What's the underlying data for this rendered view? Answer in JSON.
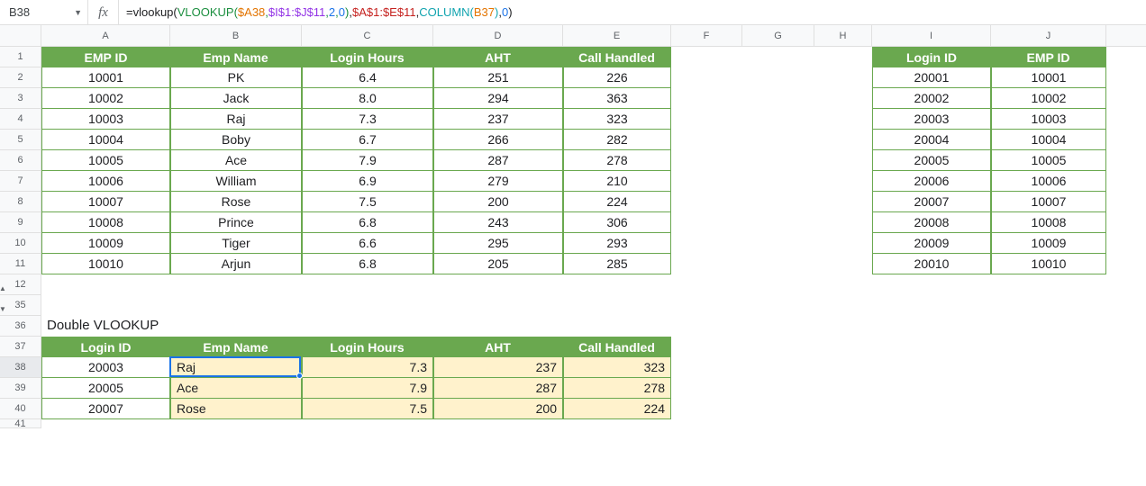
{
  "cell_ref": "B38",
  "formula_parts": [
    {
      "t": "=vlookup(",
      "c": "t-black"
    },
    {
      "t": "VLOOKUP(",
      "c": "t-green"
    },
    {
      "t": "$A38",
      "c": "t-orange"
    },
    {
      "t": ",",
      "c": "t-green"
    },
    {
      "t": "$I$1:$J$11",
      "c": "t-purple"
    },
    {
      "t": ",",
      "c": "t-green"
    },
    {
      "t": "2",
      "c": "t-blue"
    },
    {
      "t": ",",
      "c": "t-green"
    },
    {
      "t": "0",
      "c": "t-blue"
    },
    {
      "t": ")",
      "c": "t-green"
    },
    {
      "t": ",",
      "c": "t-black"
    },
    {
      "t": "$A$1:$E$11",
      "c": "t-pink"
    },
    {
      "t": ",",
      "c": "t-black"
    },
    {
      "t": "COLUMN(",
      "c": "t-teal"
    },
    {
      "t": "B37",
      "c": "t-orange"
    },
    {
      "t": ")",
      "c": "t-teal"
    },
    {
      "t": ",",
      "c": "t-black"
    },
    {
      "t": "0",
      "c": "t-blue"
    },
    {
      "t": ")",
      "c": "t-black"
    }
  ],
  "columns": [
    "A",
    "B",
    "C",
    "D",
    "E",
    "F",
    "G",
    "H",
    "I",
    "J"
  ],
  "main_headers": [
    "EMP ID",
    "Emp Name",
    "Login Hours",
    "AHT",
    "Call Handled"
  ],
  "main_rows": [
    [
      "10001",
      "PK",
      "6.4",
      "251",
      "226"
    ],
    [
      "10002",
      "Jack",
      "8.0",
      "294",
      "363"
    ],
    [
      "10003",
      "Raj",
      "7.3",
      "237",
      "323"
    ],
    [
      "10004",
      "Boby",
      "6.7",
      "266",
      "282"
    ],
    [
      "10005",
      "Ace",
      "7.9",
      "287",
      "278"
    ],
    [
      "10006",
      "William",
      "6.9",
      "279",
      "210"
    ],
    [
      "10007",
      "Rose",
      "7.5",
      "200",
      "224"
    ],
    [
      "10008",
      "Prince",
      "6.8",
      "243",
      "306"
    ],
    [
      "10009",
      "Tiger",
      "6.6",
      "295",
      "293"
    ],
    [
      "10010",
      "Arjun",
      "6.8",
      "205",
      "285"
    ]
  ],
  "lookup_headers": [
    "Login ID",
    "EMP ID"
  ],
  "lookup_rows": [
    [
      "20001",
      "10001"
    ],
    [
      "20002",
      "10002"
    ],
    [
      "20003",
      "10003"
    ],
    [
      "20004",
      "10004"
    ],
    [
      "20005",
      "10005"
    ],
    [
      "20006",
      "10006"
    ],
    [
      "20007",
      "10007"
    ],
    [
      "20008",
      "10008"
    ],
    [
      "20009",
      "10009"
    ],
    [
      "20010",
      "10010"
    ]
  ],
  "section_label": "Double VLOOKUP",
  "result_headers": [
    "Login ID",
    "Emp Name",
    "Login Hours",
    "AHT",
    "Call Handled"
  ],
  "result_rows": [
    [
      "20003",
      "Raj",
      "7.3",
      "237",
      "323"
    ],
    [
      "20005",
      "Ace",
      "7.9",
      "287",
      "278"
    ],
    [
      "20007",
      "Rose",
      "7.5",
      "200",
      "224"
    ]
  ],
  "row_labels_top": [
    "1",
    "2",
    "3",
    "4",
    "5",
    "6",
    "7",
    "8",
    "9",
    "10",
    "11",
    "12"
  ],
  "row_labels_bottom": [
    "35",
    "36",
    "37",
    "38",
    "39",
    "40",
    "41"
  ],
  "chart_data": {
    "type": "table",
    "tables": [
      {
        "name": "employees",
        "columns": [
          "EMP ID",
          "Emp Name",
          "Login Hours",
          "AHT",
          "Call Handled"
        ],
        "rows": [
          [
            "10001",
            "PK",
            6.4,
            251,
            226
          ],
          [
            "10002",
            "Jack",
            8.0,
            294,
            363
          ],
          [
            "10003",
            "Raj",
            7.3,
            237,
            323
          ],
          [
            "10004",
            "Boby",
            6.7,
            266,
            282
          ],
          [
            "10005",
            "Ace",
            7.9,
            287,
            278
          ],
          [
            "10006",
            "William",
            6.9,
            279,
            210
          ],
          [
            "10007",
            "Rose",
            7.5,
            200,
            224
          ],
          [
            "10008",
            "Prince",
            6.8,
            243,
            306
          ],
          [
            "10009",
            "Tiger",
            6.6,
            295,
            293
          ],
          [
            "10010",
            "Arjun",
            6.8,
            205,
            285
          ]
        ]
      },
      {
        "name": "login_map",
        "columns": [
          "Login ID",
          "EMP ID"
        ],
        "rows": [
          [
            "20001",
            "10001"
          ],
          [
            "20002",
            "10002"
          ],
          [
            "20003",
            "10003"
          ],
          [
            "20004",
            "10004"
          ],
          [
            "20005",
            "10005"
          ],
          [
            "20006",
            "10006"
          ],
          [
            "20007",
            "10007"
          ],
          [
            "20008",
            "10008"
          ],
          [
            "20009",
            "10009"
          ],
          [
            "20010",
            "10010"
          ]
        ]
      },
      {
        "name": "double_vlookup",
        "columns": [
          "Login ID",
          "Emp Name",
          "Login Hours",
          "AHT",
          "Call Handled"
        ],
        "rows": [
          [
            "20003",
            "Raj",
            7.3,
            237,
            323
          ],
          [
            "20005",
            "Ace",
            7.9,
            287,
            278
          ],
          [
            "20007",
            "Rose",
            7.5,
            200,
            224
          ]
        ]
      }
    ]
  }
}
